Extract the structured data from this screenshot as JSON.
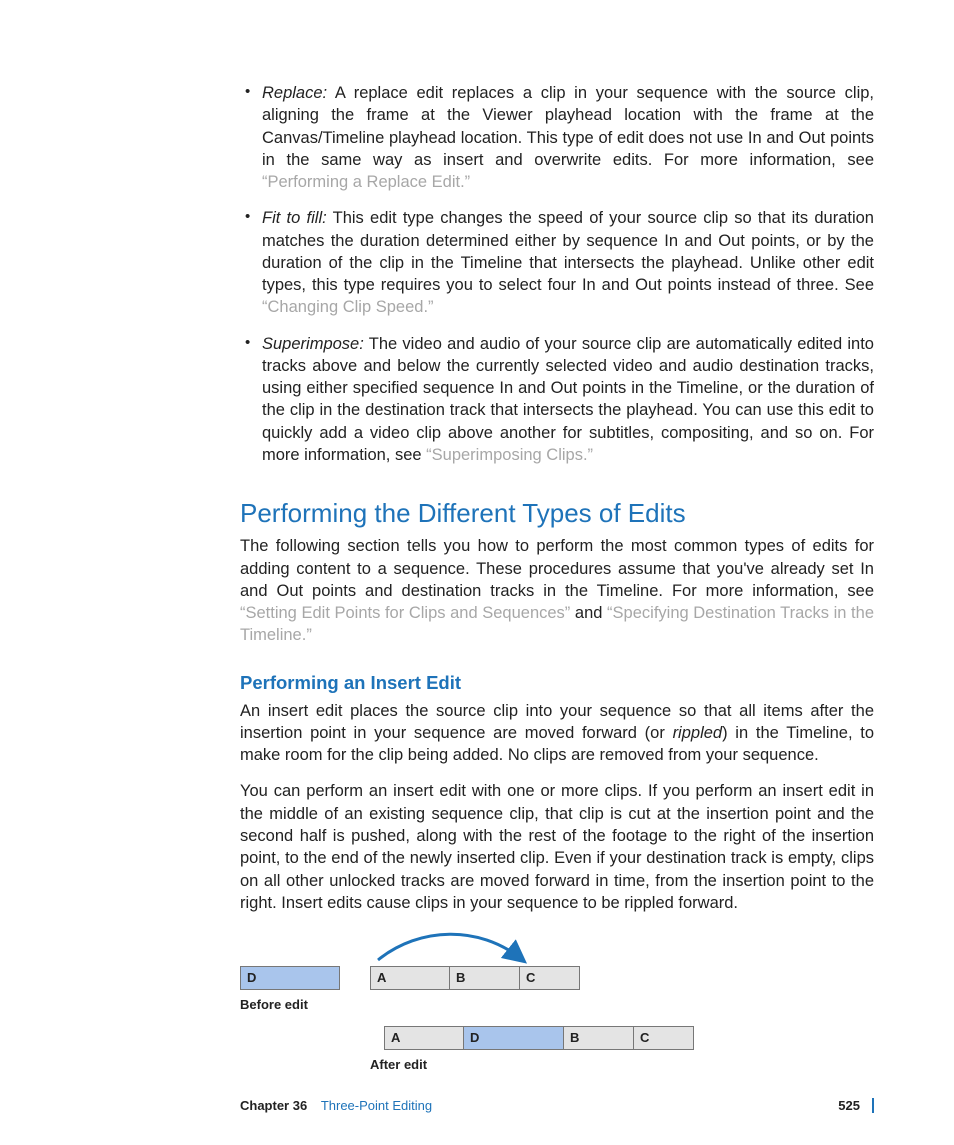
{
  "bullets": {
    "replace": {
      "term": "Replace:",
      "text_a": "  A replace edit replaces a clip in your sequence with the source clip, aligning the frame at the Viewer playhead location with the frame at the Canvas/Timeline playhead location. This type of edit does not use In and Out points in the same way as insert and overwrite edits. For more information, see ",
      "link": "“Performing a Replace Edit.”"
    },
    "fit": {
      "term": "Fit to fill:",
      "text_a": "  This edit type changes the speed of your source clip so that its duration matches the duration determined either by sequence In and Out points, or by the duration of the clip in the Timeline that intersects the playhead. Unlike other edit types, this type requires you to select four In and Out points instead of three. See ",
      "link": "“Changing Clip Speed.”"
    },
    "super": {
      "term": "Superimpose:",
      "text_a": "  The video and audio of your source clip are automatically edited into tracks above and below the currently selected video and audio destination tracks, using either specified sequence In and Out points in the Timeline, or the duration of the clip in the destination track that intersects the playhead. You can use this edit to quickly add a video clip above another for subtitles, compositing, and so on. For more information, see ",
      "link": "“Superimposing Clips.”"
    }
  },
  "section_heading": "Performing the Different Types of Edits",
  "section_intro_a": "The following section tells you how to perform the most common types of edits for adding content to a sequence. These procedures assume that you've already set In and Out points and destination tracks in the Timeline. For more information, see ",
  "section_link1": "“Setting Edit Points for Clips and Sequences”",
  "section_and": " and ",
  "section_link2": "“Specifying Destination Tracks in the Timeline.”",
  "subsection_heading": "Performing an Insert Edit",
  "insert_p1_a": "An insert edit places the source clip into your sequence so that all items after the insertion point in your sequence are moved forward (or ",
  "insert_p1_ital": "rippled",
  "insert_p1_b": ") in the Timeline, to make room for the clip being added. No clips are removed from your sequence.",
  "insert_p2": "You can perform an insert edit with one or more clips. If you perform an insert edit in the middle of an existing sequence clip, that clip is cut at the insertion point and the second half is pushed, along with the rest of the footage to the right of the insertion point, to the end of the newly inserted clip. Even if your destination track is empty, clips on all other unlocked tracks are moved forward in time, from the insertion point to the right. Insert edits cause clips in your sequence to be rippled forward.",
  "diagram": {
    "before_label": "Before edit",
    "after_label": "After edit",
    "D": "D",
    "A": "A",
    "B": "B",
    "C": "C"
  },
  "footer": {
    "chapter_label": "Chapter 36",
    "chapter_name": "Three-Point Editing",
    "page": "525"
  }
}
